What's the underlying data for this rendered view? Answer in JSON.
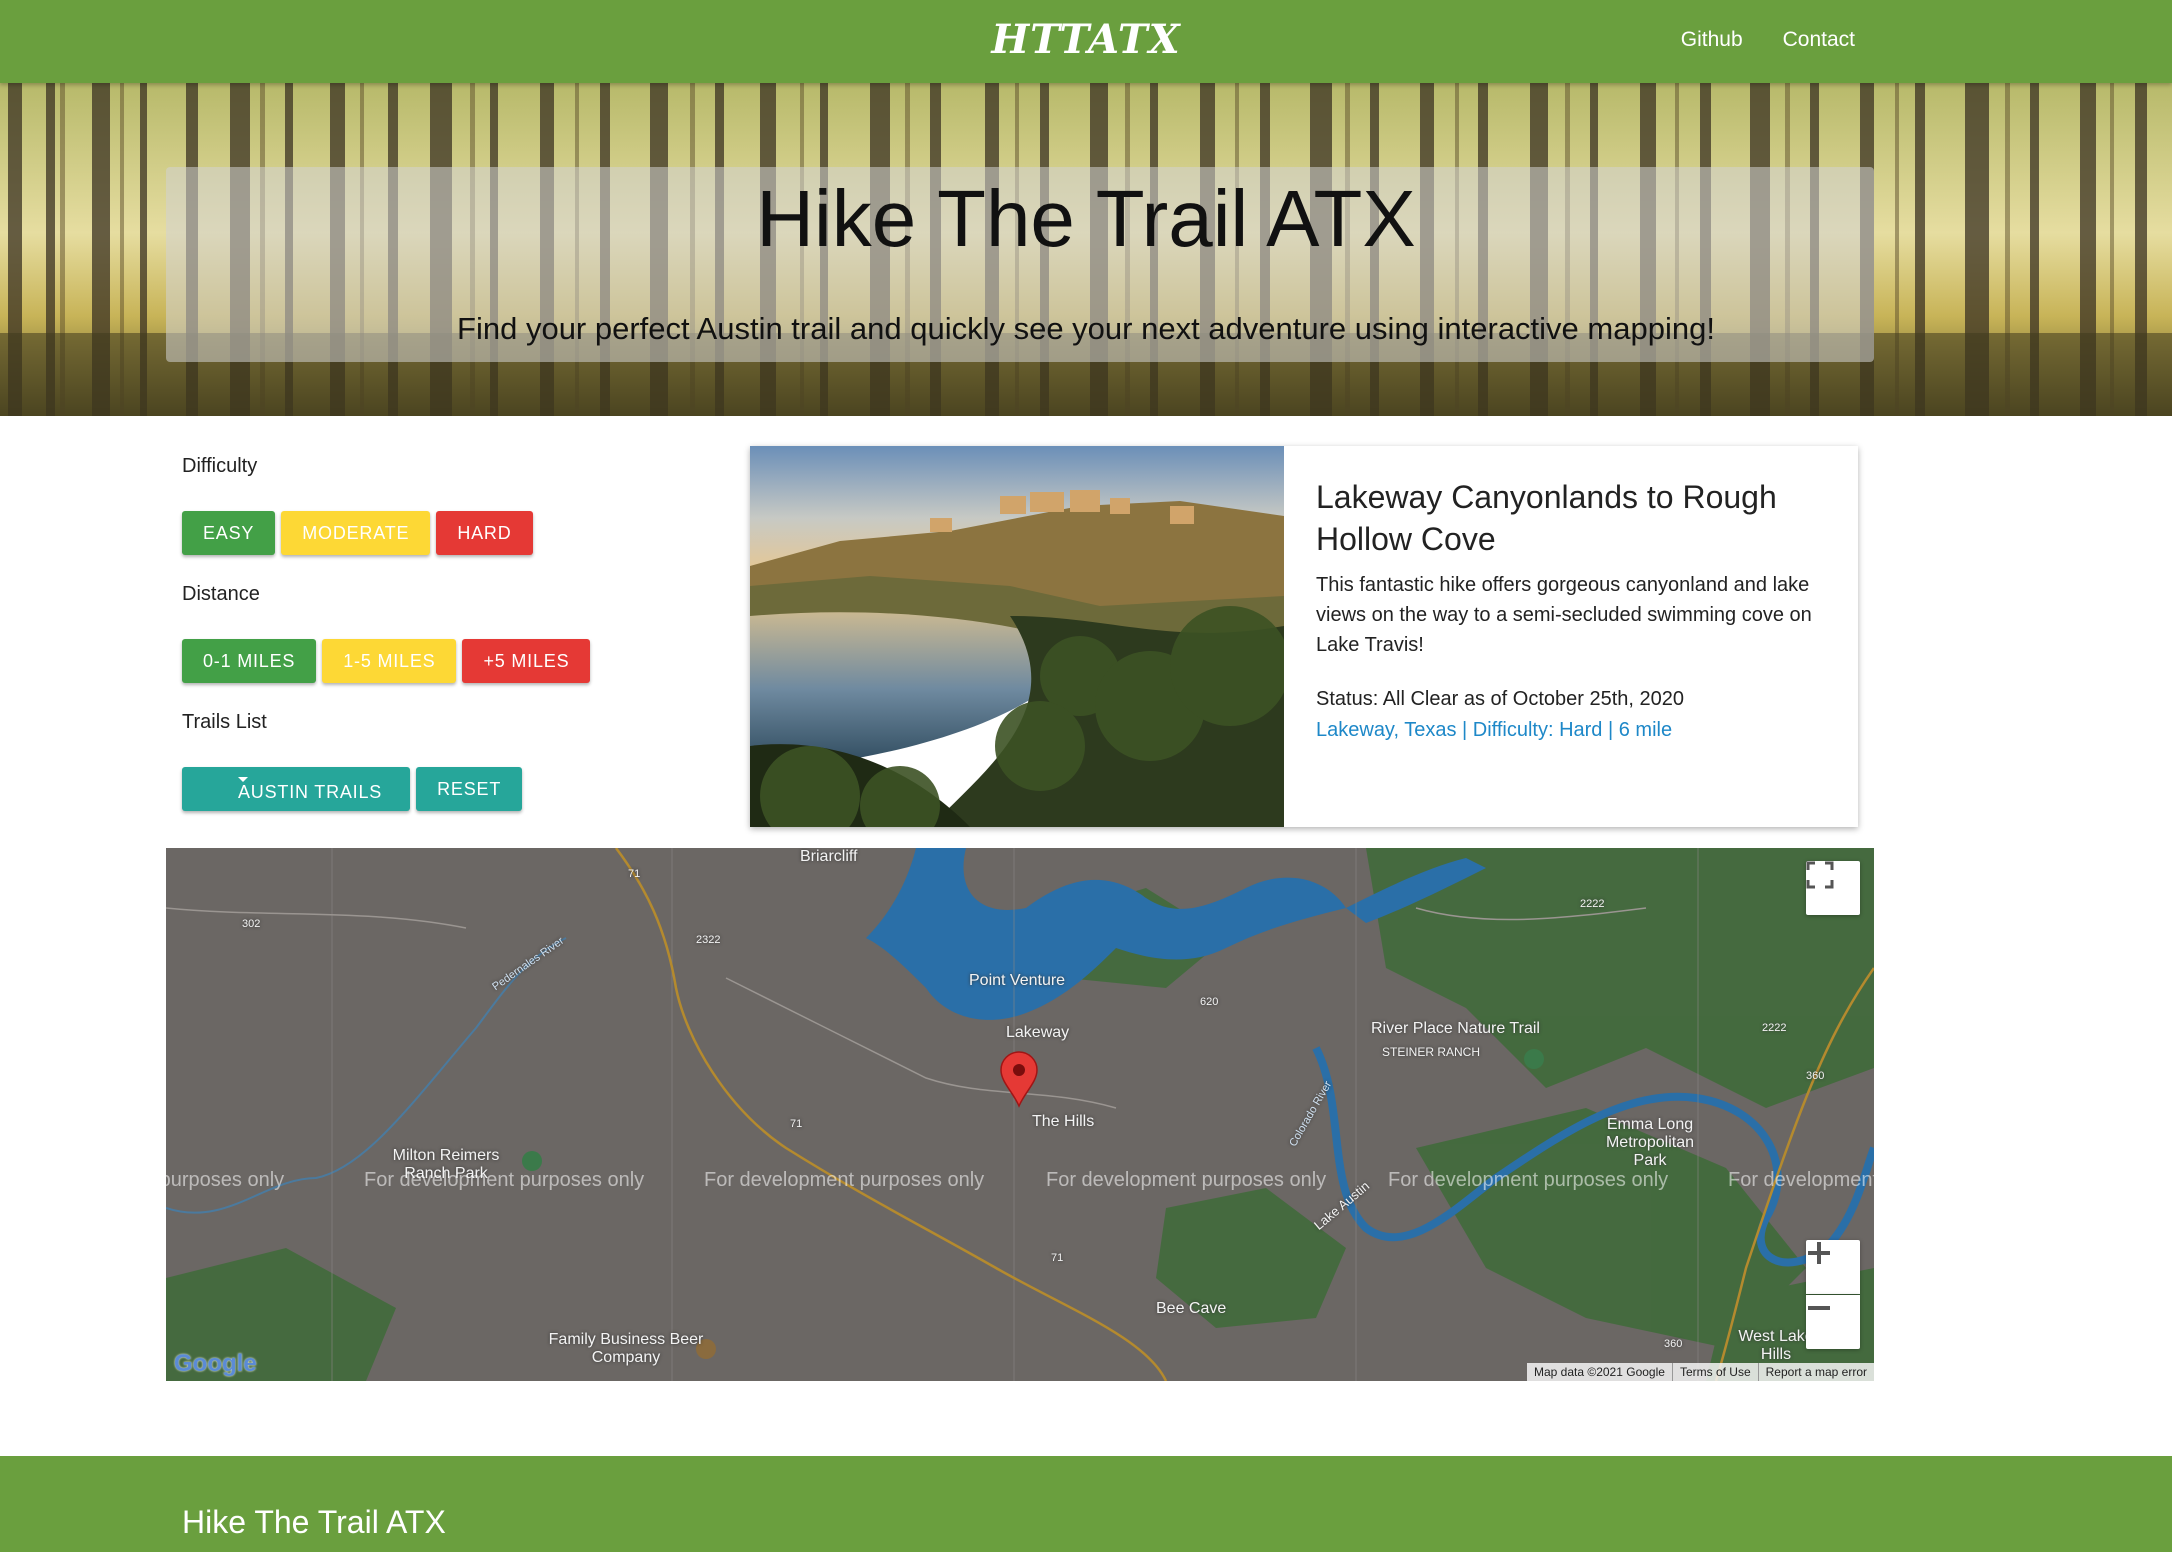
{
  "nav": {
    "brand": "HTTATX",
    "links": [
      "Github",
      "Contact"
    ]
  },
  "hero": {
    "title": "Hike The Trail ATX",
    "subtitle": "Find your perfect Austin trail and quickly see your next adventure using interactive mapping!"
  },
  "filters": {
    "difficulty_label": "Difficulty",
    "difficulty_buttons": [
      "EASY",
      "MODERATE",
      "HARD"
    ],
    "distance_label": "Distance",
    "distance_buttons": [
      "0-1 MILES",
      "1-5 MILES",
      "+5 MILES"
    ],
    "trails_label": "Trails List",
    "trails_dropdown": "AUSTIN TRAILS",
    "reset": "RESET"
  },
  "card": {
    "title": "Lakeway Canyonlands to Rough Hollow Cove",
    "description": "This fantastic hike offers gorgeous canyonland and lake views on the way to a semi-secluded swimming cove on Lake Travis!",
    "status": "Status: All Clear as of October 25th, 2020",
    "meta": "Lakeway, Texas | Difficulty: Hard | 6 mile"
  },
  "map": {
    "watermark": "For development purposes only",
    "places": {
      "briarcliff": "Briarcliff",
      "point_venture": "Point Venture",
      "lakeway": "Lakeway",
      "the_hills": "The Hills",
      "river_place": "River Place Nature Trail",
      "steiner_ranch": "STEINER RANCH",
      "milton_reimers": "Milton Reimers Ranch Park",
      "emma_long": "Emma Long Metropolitan Park",
      "bee_cave": "Bee Cave",
      "family_business": "Family Business Beer Company",
      "west_lake_hills": "West Lake Hills",
      "lake_austin": "Lake Austin",
      "colorado_river": "Colorado River",
      "pedernales_river": "Pedernales River"
    },
    "roads": [
      "71",
      "302",
      "2322",
      "620",
      "2222",
      "2222",
      "360",
      "71",
      "71",
      "360"
    ],
    "attribution": [
      "Map data ©2021 Google",
      "Terms of Use",
      "Report a map error"
    ],
    "logo": "Google"
  },
  "footer": {
    "title": "Hike The Trail ATX"
  },
  "colors": {
    "nav_green": "#6a9f3e",
    "easy": "#43a047",
    "moderate": "#fdd835",
    "hard": "#e53935",
    "teal": "#26a69a",
    "link": "#1e88c8"
  }
}
